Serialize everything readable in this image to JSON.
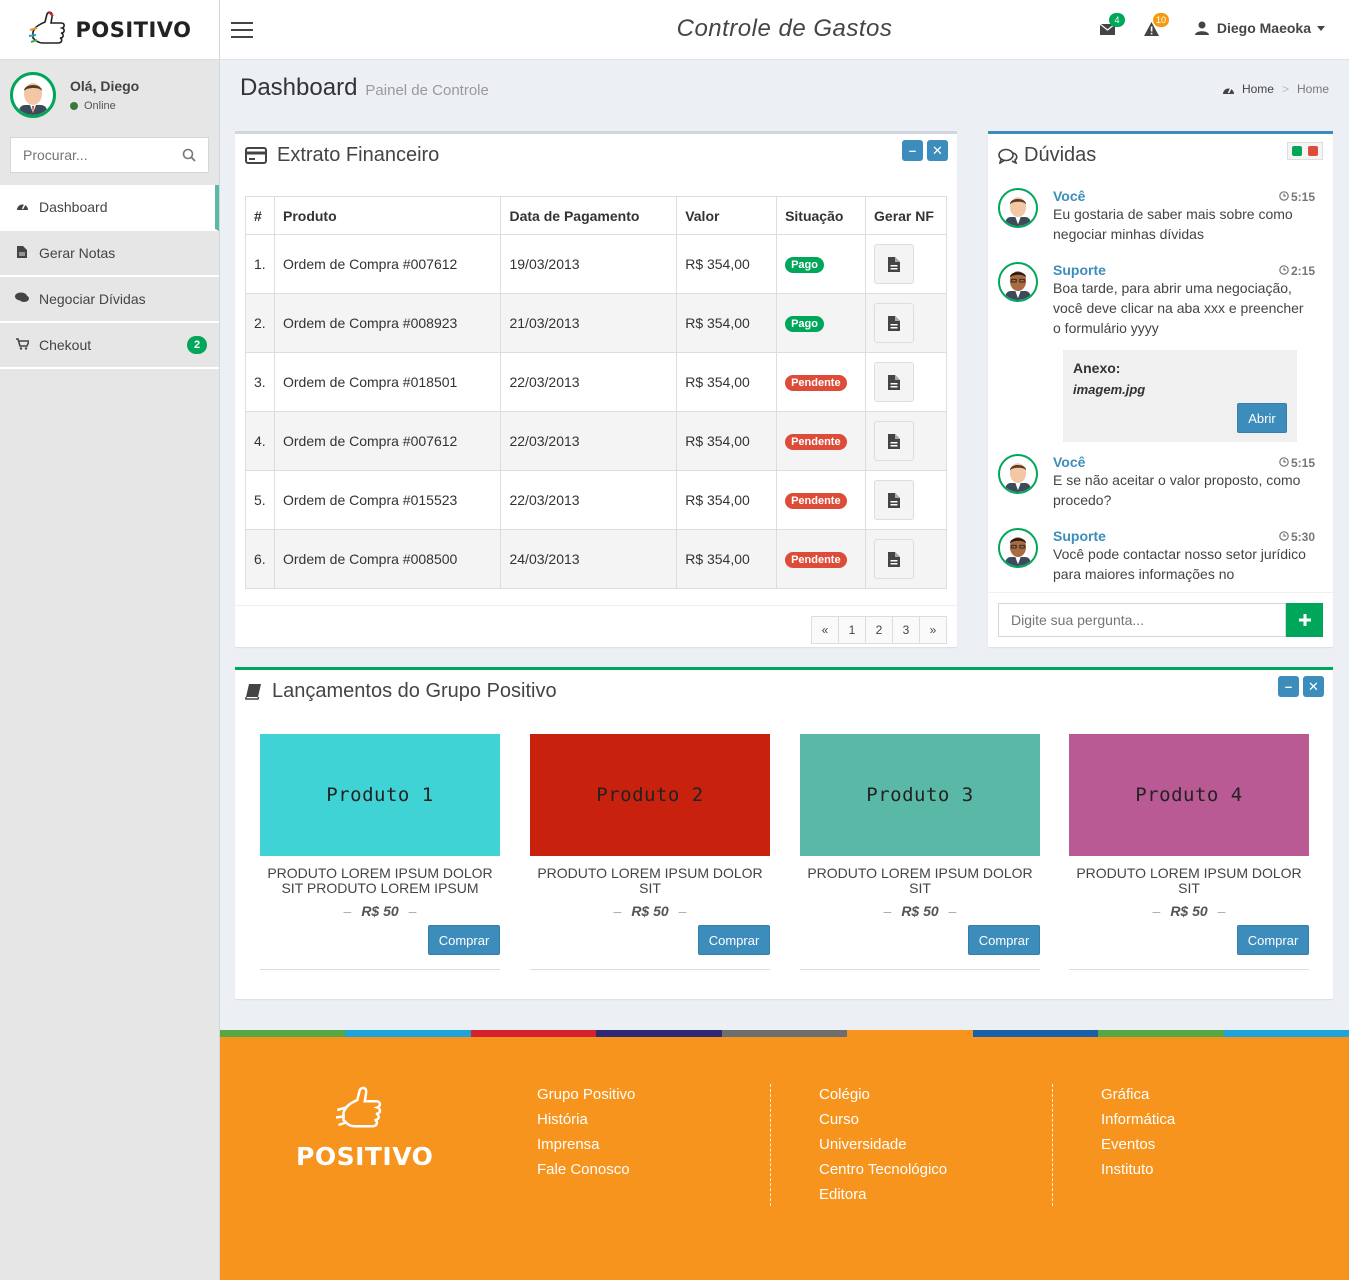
{
  "brand": {
    "name": "POSITIVO"
  },
  "sidebar": {
    "greeting": "Olá, Diego",
    "status": "Online",
    "search_placeholder": "Procurar...",
    "items": [
      {
        "label": "Dashboard",
        "icon": "dashboard-icon",
        "active": true
      },
      {
        "label": "Gerar Notas",
        "icon": "file-icon"
      },
      {
        "label": "Negociar Dívidas",
        "icon": "comments-icon"
      },
      {
        "label": "Chekout",
        "icon": "cart-icon",
        "badge": "2"
      }
    ]
  },
  "header": {
    "title": "Controle de Gastos",
    "mail_count": "4",
    "alert_count": "10",
    "user": "Diego Maeoka"
  },
  "page": {
    "title": "Dashboard",
    "subtitle": "Painel de Controle",
    "breadcrumb": [
      "Home",
      ">",
      "Home"
    ]
  },
  "statement": {
    "title": "Extrato Financeiro",
    "columns": [
      "#",
      "Produto",
      "Data de Pagamento",
      "Valor",
      "Situação",
      "Gerar NF"
    ],
    "rows": [
      {
        "n": "1.",
        "product": "Ordem de Compra #007612",
        "date": "19/03/2013",
        "value": "R$ 354,00",
        "status": "Pago"
      },
      {
        "n": "2.",
        "product": "Ordem de Compra #008923",
        "date": "21/03/2013",
        "value": "R$ 354,00",
        "status": "Pago"
      },
      {
        "n": "3.",
        "product": "Ordem de Compra #018501",
        "date": "22/03/2013",
        "value": "R$ 354,00",
        "status": "Pendente"
      },
      {
        "n": "4.",
        "product": "Ordem de Compra #007612",
        "date": "22/03/2013",
        "value": "R$ 354,00",
        "status": "Pendente"
      },
      {
        "n": "5.",
        "product": "Ordem de Compra #015523",
        "date": "22/03/2013",
        "value": "R$ 354,00",
        "status": "Pendente"
      },
      {
        "n": "6.",
        "product": "Ordem de Compra #008500",
        "date": "24/03/2013",
        "value": "R$ 354,00",
        "status": "Pendente"
      }
    ],
    "pagination": [
      "«",
      "1",
      "2",
      "3",
      "»"
    ]
  },
  "chat": {
    "title": "Dúvidas",
    "messages": [
      {
        "who": "Você",
        "time": "5:15",
        "text": "Eu gostaria de saber mais sobre como negociar minhas dívidas"
      },
      {
        "who": "Suporte",
        "time": "2:15",
        "text": "Boa tarde, para abrir uma negociação, você deve clicar na aba xxx e preencher o formulário yyyy"
      },
      {
        "who": "Você",
        "time": "5:15",
        "text": "E se não aceitar o valor proposto, como procedo?"
      },
      {
        "who": "Suporte",
        "time": "5:30",
        "text": "Você pode contactar nosso setor jurídico para maiores informações no"
      }
    ],
    "attachment": {
      "title": "Anexo:",
      "file": "imagem.jpg",
      "button": "Abrir"
    },
    "input_placeholder": "Digite sua pergunta..."
  },
  "products": {
    "title": "Lançamentos do Grupo Positivo",
    "items": [
      {
        "name": "Produto 1",
        "desc": "PRODUTO LOREM IPSUM DOLOR SIT PRODUTO LOREM IPSUM",
        "price": "R$ 50",
        "button": "Comprar",
        "color": "#3fd3d5"
      },
      {
        "name": "Produto 2",
        "desc": "PRODUTO LOREM IPSUM DOLOR SIT",
        "price": "R$ 50",
        "button": "Comprar",
        "color": "#c8220f"
      },
      {
        "name": "Produto 3",
        "desc": "PRODUTO LOREM IPSUM DOLOR SIT",
        "price": "R$ 50",
        "button": "Comprar",
        "color": "#5ab9a6"
      },
      {
        "name": "Produto 4",
        "desc": "PRODUTO LOREM IPSUM DOLOR SIT",
        "price": "R$ 50",
        "button": "Comprar",
        "color": "#b95a94"
      }
    ]
  },
  "footer": {
    "stripe_colors": [
      "#57a843",
      "#1fa4da",
      "#d5202e",
      "#2d2a73",
      "#6e6e6e",
      "#f7941d",
      "#1a5fa8",
      "#57a843",
      "#1fa4da"
    ],
    "columns": [
      [
        "Grupo Positivo",
        "História",
        "Imprensa",
        "Fale Conosco"
      ],
      [
        "Colégio",
        "Curso",
        "Universidade",
        "Centro Tecnológico",
        "Editora"
      ],
      [
        "Gráfica",
        "Informática",
        "Eventos",
        "Instituto"
      ]
    ]
  },
  "colors": {
    "accent": "#3c8dbc",
    "success": "#00a65a",
    "danger": "#dd4b39",
    "footer": "#f7941d"
  }
}
